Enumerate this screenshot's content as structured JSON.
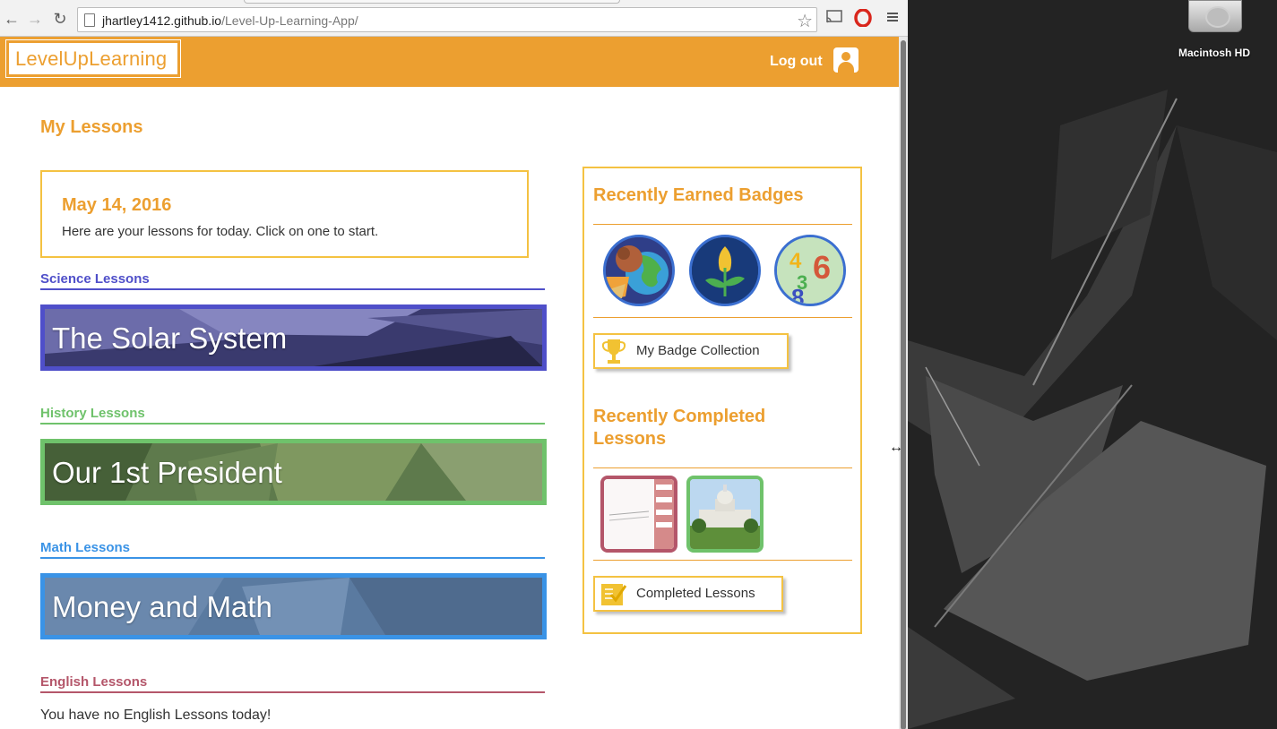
{
  "browser": {
    "url_host": "jhartley1412.github.io",
    "url_path": "/Level-Up-Learning-App/"
  },
  "desktop": {
    "drive_label": "Macintosh HD"
  },
  "header": {
    "logo_text": "LevelUpLearning",
    "logout_label": "Log out"
  },
  "main": {
    "title": "My Lessons",
    "date": "May 14, 2016",
    "intro": "Here are your lessons for today. Click on one to start.",
    "sections": [
      {
        "label": "Science Lessons",
        "color": "#4f4fc9",
        "lesson": "The Solar System"
      },
      {
        "label": "History Lessons",
        "color": "#6fc26b",
        "lesson": "Our 1st President"
      },
      {
        "label": "Math Lessons",
        "color": "#3a93e6",
        "lesson": "Money and Math"
      },
      {
        "label": "English Lessons",
        "color": "#b4566a",
        "empty_text": "You have no English Lessons today!"
      }
    ]
  },
  "sidebar": {
    "badges_title": "Recently Earned Badges",
    "badges": [
      "globe-badge",
      "flower-badge",
      "numbers-badge"
    ],
    "badge_collection_label": "My Badge Collection",
    "completed_title_line1": "Recently Completed",
    "completed_title_line2": "Lessons",
    "completed_lessons_label": "Completed Lessons"
  },
  "colors": {
    "brand_orange": "#ec9f30",
    "accent_yellow": "#f4c242"
  }
}
